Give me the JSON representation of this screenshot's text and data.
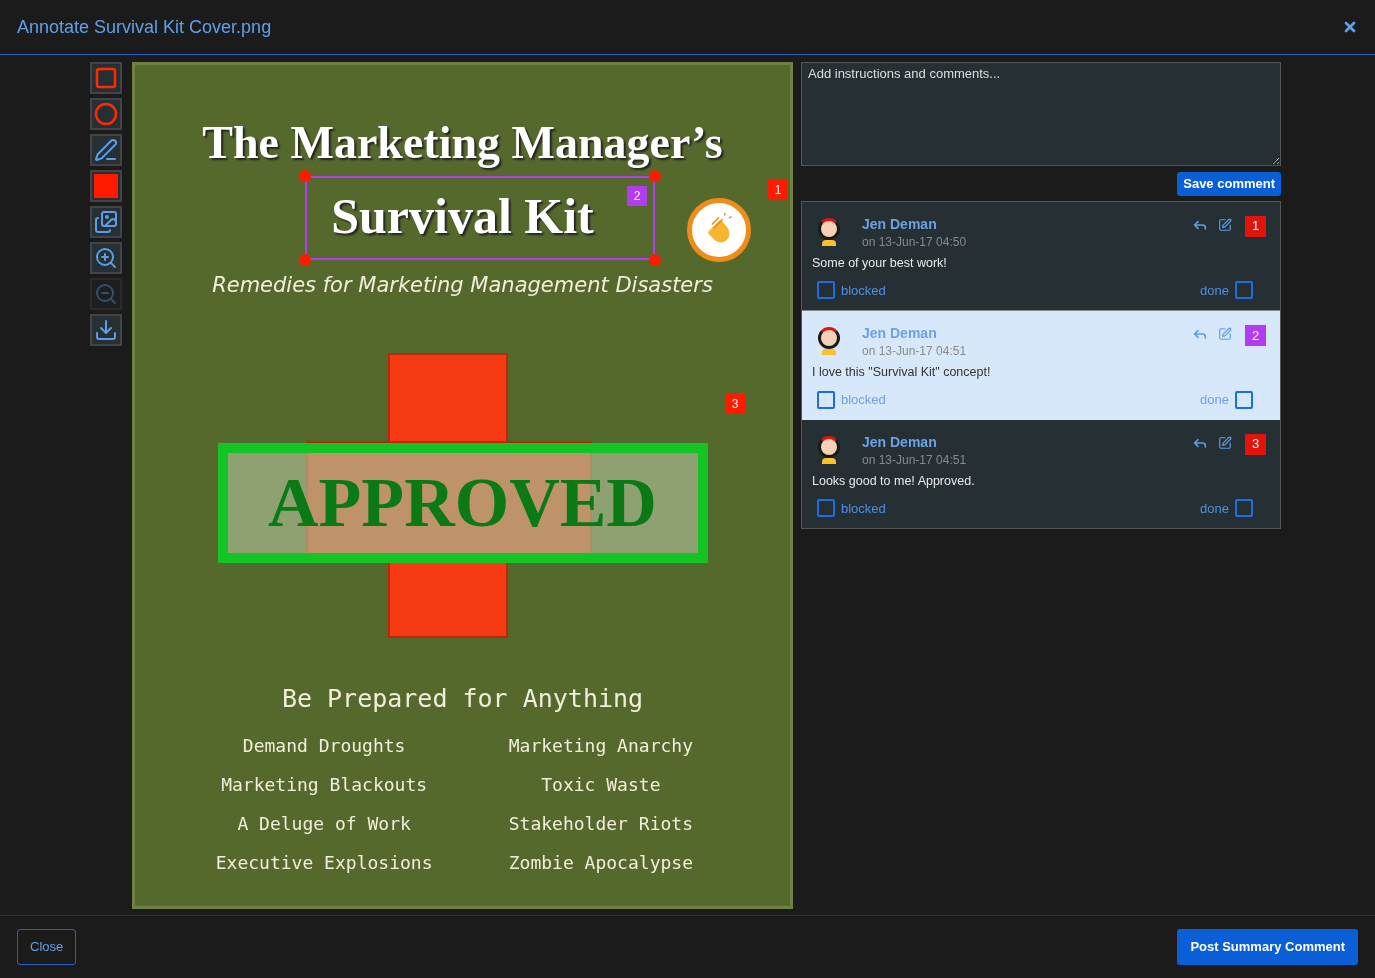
{
  "window": {
    "title": "Annotate Survival Kit Cover.png"
  },
  "tools": [
    {
      "kind": "rectangle",
      "disabled": false
    },
    {
      "kind": "circle",
      "disabled": false
    },
    {
      "kind": "pen",
      "disabled": false
    },
    {
      "kind": "color",
      "disabled": false
    },
    {
      "kind": "images",
      "disabled": false
    },
    {
      "kind": "zoom-in",
      "disabled": false
    },
    {
      "kind": "zoom-out",
      "disabled": true
    },
    {
      "kind": "download",
      "disabled": false
    }
  ],
  "image": {
    "title_line1": "The Marketing Manager’s",
    "title_line2": "Survival Kit",
    "subtitle": "Remedies for Marketing Management Disasters",
    "stamp": "APPROVED",
    "tagline": "Be Prepared for Anything",
    "topics": [
      "Demand Droughts",
      "Marketing Anarchy",
      "Marketing Blackouts",
      "Toxic Waste",
      "A Deluge of Work",
      "Stakeholder Riots",
      "Executive Explosions",
      "Zombie Apocalypse"
    ]
  },
  "markers": [
    {
      "label": "1",
      "color": "#ff1a00"
    },
    {
      "label": "2",
      "color": "#b23cf0"
    },
    {
      "label": "3",
      "color": "#ff1a00"
    }
  ],
  "comment_box": {
    "placeholder": "Add instructions and comments...",
    "button": "Save comment"
  },
  "comments": [
    {
      "author": "Jen Deman",
      "time": "on 13-Jun-17 04:50",
      "text": "Some of your best work!",
      "marker": "1",
      "color": "#e0140a",
      "selected": false,
      "blocked": false,
      "done": false,
      "blocked_label": "blocked",
      "done_label": "done"
    },
    {
      "author": "Jen Deman",
      "time": "on 13-Jun-17 04:51",
      "text": "I love this \"Survival Kit\" concept!",
      "marker": "2",
      "color": "#b23cf0",
      "selected": true,
      "blocked": false,
      "done": false,
      "blocked_label": "blocked",
      "done_label": "done"
    },
    {
      "author": "Jen Deman",
      "time": "on 13-Jun-17 04:51",
      "text": "Looks good to me!  Approved.",
      "marker": "3",
      "color": "#e0140a",
      "selected": false,
      "blocked": false,
      "done": false,
      "blocked_label": "blocked",
      "done_label": "done"
    }
  ],
  "footer": {
    "close": "Close",
    "post": "Post Summary Comment"
  }
}
